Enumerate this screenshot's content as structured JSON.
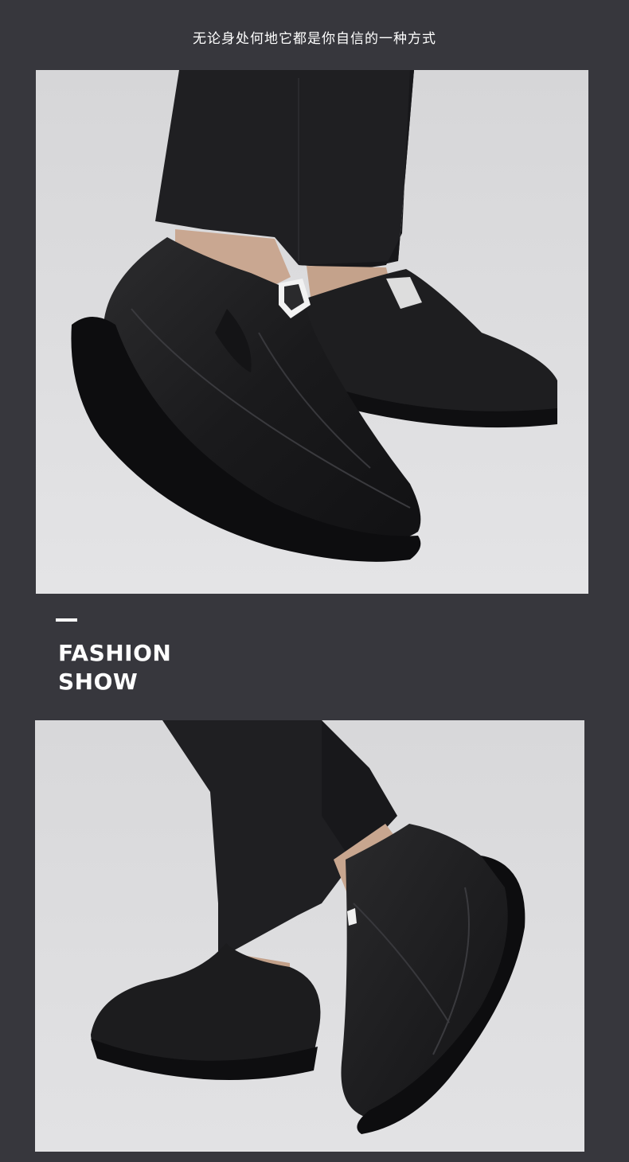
{
  "header": {
    "tagline": "无论身处何地它都是你自信的一种方式"
  },
  "section": {
    "title_line_1": "FASHION",
    "title_line_2": "SHOW"
  },
  "colors": {
    "page_background": "#37373d",
    "photo_background": "#dcdcde",
    "text": "#ffffff",
    "shoe": "#1c1c1e",
    "trousers": "#1f1f22"
  }
}
